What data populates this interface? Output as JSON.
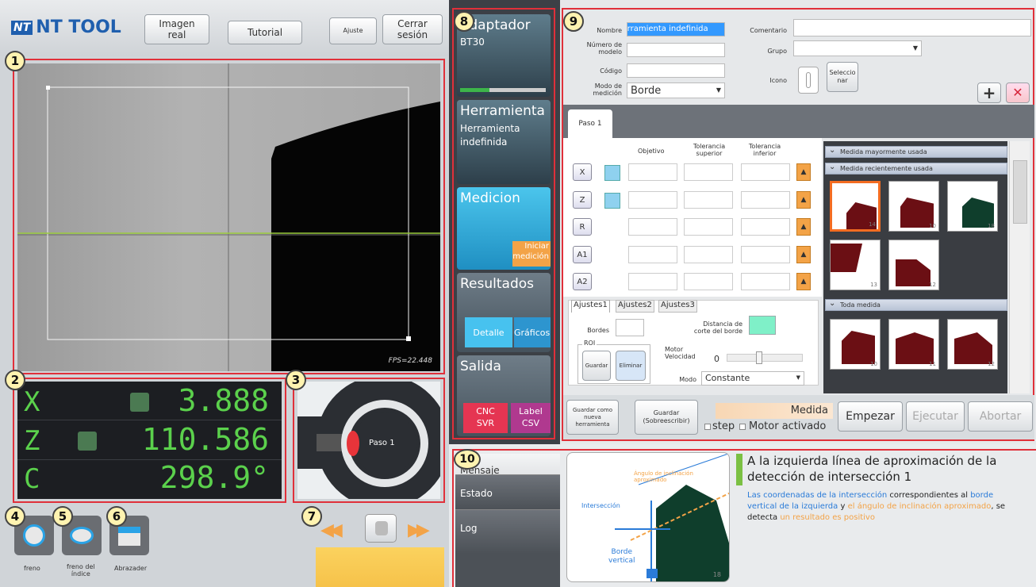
{
  "header": {
    "logo_badge": "NT",
    "logo_text": "NT TOOL",
    "imagen_real": "Imagen\nreal",
    "tutorial": "Tutorial",
    "ajuste": "Ajuste",
    "cerrar": "Cerrar\nsesión"
  },
  "badges": [
    "1",
    "2",
    "3",
    "4",
    "5",
    "6",
    "7",
    "8",
    "9",
    "10"
  ],
  "camera": {
    "fps": "FPS=22.448"
  },
  "readout": {
    "x_label": "X",
    "x_value": "3.888",
    "z_label": "Z",
    "z_value": "110.586",
    "c_label": "C",
    "c_value": "298.9°"
  },
  "turret": {
    "step_label": "Paso 1"
  },
  "bottom_tools": {
    "freno": "freno",
    "freno_indice": "freno del\níndice",
    "abrazadera": "Abrazader"
  },
  "side": {
    "adaptador_title": "Adaptador",
    "adaptador_value": "BT30",
    "herramienta_title": "Herramienta",
    "herramienta_value": "Herramienta\nindefinida",
    "medicion_title": "Medicion",
    "iniciar": "Iniciar\nmedición",
    "resultados_title": "Resultados",
    "detalle": "Detalle",
    "graficos": "Gráficos",
    "salida_title": "Salida",
    "cnc": "CNC\nSVR",
    "label_csv": "Label\nCSV"
  },
  "form": {
    "nombre_label": "Nombre",
    "nombre_value": "Herramienta indefinida",
    "numero_label": "Número de\nmodelo",
    "codigo_label": "Código",
    "modo_label": "Modo de\nmedición",
    "modo_value": "Borde",
    "comentario_label": "Comentario",
    "grupo_label": "Grupo",
    "icono_label": "Icono",
    "seleccionar": "Seleccio\nnar",
    "add": "+",
    "remove": "✕"
  },
  "step_tab": "Paso 1",
  "grid": {
    "col_objetivo": "Objetivo",
    "col_tol_sup": "Tolerancia\nsuperior",
    "col_tol_inf": "Tolerancia\ninferior",
    "rows": [
      "X",
      "Z",
      "R",
      "A1",
      "A2"
    ]
  },
  "settings_tabs": [
    "Ajustes1",
    "Ajustes2",
    "Ajustes3"
  ],
  "settings": {
    "bordes": "Bordes",
    "distancia": "Distancia de\ncorte del borde",
    "roi": "ROI",
    "guardar": "Guardar",
    "eliminar": "Eliminar",
    "motor_vel": "Motor\nVelocidad",
    "motor_value": "0",
    "modo": "Modo",
    "modo_value": "Constante"
  },
  "library": {
    "mayormente": "Medida mayormente usada",
    "recientemente": "Medida recientemente usada",
    "todo": "Toda medida",
    "nums_recent": [
      "14",
      "10",
      "18"
    ],
    "nums_recent2": [
      "13",
      "12"
    ],
    "nums_all": [
      "10",
      "11",
      "12"
    ]
  },
  "bottom_bar": {
    "guardar_nueva": "Guardar como\nnueva\nherramienta",
    "guardar_sob": "Guardar\n(Sobreescribir)",
    "medida": "Medida",
    "step": "step",
    "motor": "Motor activado",
    "empezar": "Empezar",
    "ejecutar": "Ejecutar",
    "abortar": "Abortar"
  },
  "message_tabs": [
    "Mensaje",
    "Estado",
    "Log"
  ],
  "diagram": {
    "angle_label": "Ángulo de inclinación\naproximado",
    "intersection_label": "Intersección",
    "edge_label": "Borde\nvertical",
    "num": "18"
  },
  "help": {
    "title": "A la izquierda línea de aproximación de la detección de intersección 1",
    "p1": "Las coordenadas de la intersección",
    "p2": " correspondientes al ",
    "p3": "borde vertical de la izquierda",
    "p4": " y ",
    "p5": "el ángulo de inclinación aproximado",
    "p6": ", se detecta ",
    "p7": "un resultado es positivo"
  },
  "colors": {
    "accent_red": "#e0303a",
    "green": "#5bd14c",
    "orange": "#f3a347",
    "maroon": "#6b0f14"
  }
}
